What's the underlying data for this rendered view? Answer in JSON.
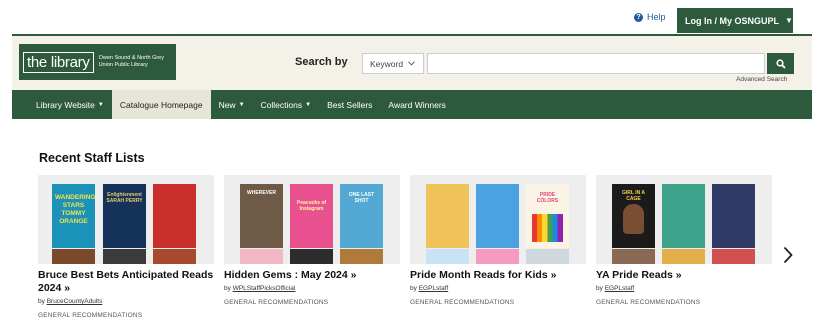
{
  "util": {
    "help_label": "Help",
    "login_label": "Log In / My OSNGUPL"
  },
  "header": {
    "logo_mark": "the library",
    "logo_sub": "Owen Sound & North Grey Union Public Library",
    "search_label": "Search by",
    "search_type": "Keyword",
    "search_value": "",
    "advanced_search": "Advanced Search"
  },
  "nav": {
    "items": [
      {
        "label": "Library Website",
        "has_menu": true
      },
      {
        "label": "Catalogue Homepage",
        "has_menu": false
      },
      {
        "label": "New",
        "has_menu": true
      },
      {
        "label": "Collections",
        "has_menu": true
      },
      {
        "label": "Best Sellers",
        "has_menu": false
      },
      {
        "label": "Award Winners",
        "has_menu": false
      }
    ]
  },
  "section": {
    "title": "Recent Staff Lists"
  },
  "cards": [
    {
      "title": "Bruce Best Bets Anticipated Reads 2024",
      "by_prefix": "by",
      "author": "BruceCountyAdults",
      "category": "GENERAL RECOMMENDATIONS"
    },
    {
      "title": "Hidden Gems : May 2024",
      "by_prefix": "by",
      "author": "WPLStaffPicksOfficial",
      "category": "GENERAL RECOMMENDATIONS"
    },
    {
      "title": "Pride Month Reads for Kids",
      "by_prefix": "by",
      "author": "EGPLstaff",
      "category": "GENERAL RECOMMENDATIONS"
    },
    {
      "title": "YA Pride Reads",
      "by_prefix": "by",
      "author": "EGPLstaff",
      "category": "GENERAL RECOMMENDATIONS"
    }
  ],
  "covers": {
    "c1b1_text": "WANDERING STARS TOMMY ORANGE",
    "c1b2_text": "Enlightenment SARAH PERRY",
    "c2b1_text": "WHEREVER",
    "c2b2_text": "Peacocks of Instagram",
    "c2b3_text": "ONE LAST SHOT",
    "c3b3_text": "PRIDE COLORS",
    "c4b1_text": "GIRL IN A CAGE"
  },
  "colors": {
    "brand_green": "#2d5a3d",
    "link_blue": "#1f5c9e",
    "header_bg": "#f4f1e8"
  },
  "icons": {
    "help": "question-circle-icon",
    "search": "magnifier-icon",
    "next": "chevron-right-icon"
  }
}
